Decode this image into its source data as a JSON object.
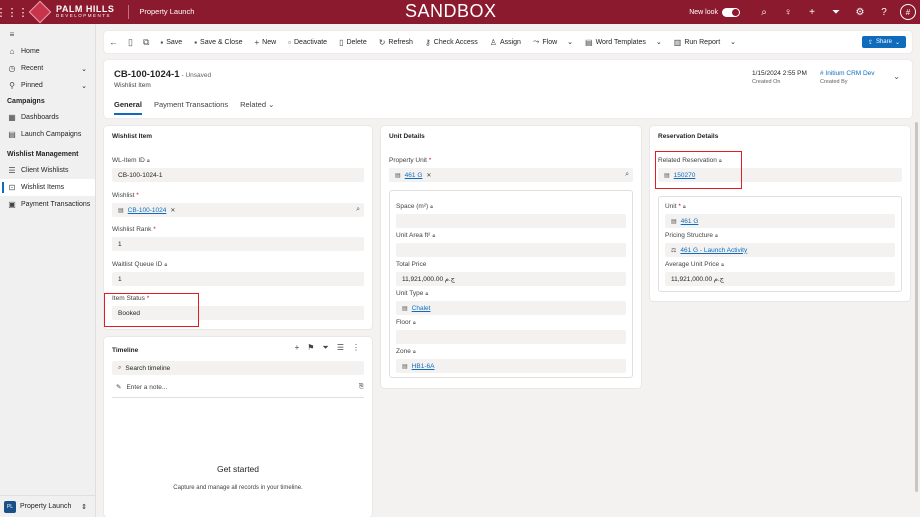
{
  "topbar": {
    "brand_line1": "PALM HILLS",
    "brand_line2": "DEVELOPMENTS",
    "app_name": "Property Launch",
    "environment": "SANDBOX",
    "new_look_label": "New look",
    "user_initial": "#",
    "bg_color": "#8b1a2f"
  },
  "sidebar": {
    "items_top": [
      {
        "label": "Home",
        "icon": "home-icon"
      },
      {
        "label": "Recent",
        "icon": "clock-icon"
      },
      {
        "label": "Pinned",
        "icon": "pin-icon"
      }
    ],
    "section1": "Campaigns",
    "campaign_items": [
      {
        "label": "Dashboards",
        "icon": "dashboard-icon"
      },
      {
        "label": "Launch Campaigns",
        "icon": "campaign-icon"
      }
    ],
    "section2": "Wishlist Management",
    "wishlist_items": [
      {
        "label": "Client Wishlists",
        "icon": "list-icon"
      },
      {
        "label": "Wishlist Items",
        "icon": "cart-icon"
      },
      {
        "label": "Payment Transactions",
        "icon": "document-icon"
      }
    ],
    "area_badge": "PL",
    "area_name": "Property Launch"
  },
  "commands": {
    "save": "Save",
    "save_close": "Save & Close",
    "new": "New",
    "deactivate": "Deactivate",
    "delete": "Delete",
    "refresh": "Refresh",
    "check_access": "Check Access",
    "assign": "Assign",
    "flow": "Flow",
    "word_templates": "Word Templates",
    "run_report": "Run Report",
    "share": "Share"
  },
  "record": {
    "title": "CB-100-1024-1",
    "status": "- Unsaved",
    "entity": "Wishlist Item",
    "created_on_value": "1/15/2024 2:55 PM",
    "created_on_label": "Created On",
    "created_by_value": "# Initium CRM Dev",
    "created_by_label": "Created By",
    "tabs": [
      "General",
      "Payment Transactions",
      "Related"
    ]
  },
  "wishlist_item": {
    "title": "Wishlist Item",
    "wl_item_id_label": "WL-Item ID",
    "wl_item_id": "CB-100-1024-1",
    "wishlist_label": "Wishlist",
    "wishlist": "CB-100-1024",
    "rank_label": "Wishlist Rank",
    "rank": "1",
    "queue_label": "Waitlist Queue ID",
    "queue": "1",
    "status_label": "Item Status",
    "status": "Booked"
  },
  "timeline": {
    "title": "Timeline",
    "search_placeholder": "Search timeline",
    "note_placeholder": "Enter a note...",
    "empty_title": "Get started",
    "empty_sub": "Capture and manage all records in your timeline."
  },
  "unit_details": {
    "title": "Unit Details",
    "property_unit_label": "Property Unit",
    "property_unit": "461 G",
    "space_label": "Space (m²)",
    "space": "",
    "unit_area_label": "Unit Area ft²",
    "unit_area": "",
    "total_price_label": "Total Price",
    "total_price": "11,921,000.00 ج.م",
    "unit_type_label": "Unit Type",
    "unit_type": "Chalet",
    "floor_label": "Floor",
    "floor": "",
    "zone_label": "Zone",
    "zone": "HB1-6A"
  },
  "reservation": {
    "title": "Reservation Details",
    "related_label": "Related Reservation",
    "related": "150270",
    "unit_label": "Unit",
    "unit": "461 G",
    "pricing_label": "Pricing Structure",
    "pricing": "461 G - Launch Activity",
    "avg_price_label": "Average Unit Price",
    "avg_price": "11,921,000.00 ج.م"
  }
}
